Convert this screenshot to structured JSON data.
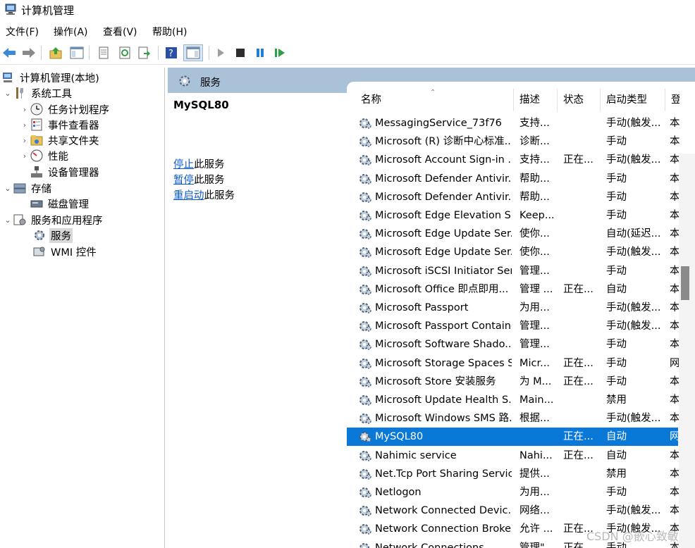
{
  "window": {
    "title": "计算机管理"
  },
  "menu": [
    "文件(F)",
    "操作(A)",
    "查看(V)",
    "帮助(H)"
  ],
  "toolbar": {
    "buttons": [
      "back-icon",
      "forward-icon",
      "up-icon",
      "show-hide-tree-icon",
      "properties-icon",
      "refresh-icon",
      "export-icon",
      "help-icon",
      "action-pane-icon",
      "start-icon",
      "stop-icon",
      "pause-icon",
      "resume-icon"
    ]
  },
  "tree": {
    "root": "计算机管理(本地)",
    "system_tools": "系统工具",
    "task_scheduler": "任务计划程序",
    "event_viewer": "事件查看器",
    "shared_folders": "共享文件夹",
    "performance": "性能",
    "device_manager": "设备管理器",
    "storage": "存储",
    "disk_management": "磁盘管理",
    "services_apps": "服务和应用程序",
    "services": "服务",
    "wmi": "WMI 控件"
  },
  "pane": {
    "title": "服务",
    "selected_service": "MySQL80",
    "actions": [
      {
        "link": "停止",
        "suffix": "此服务"
      },
      {
        "link": "暂停",
        "suffix": "此服务"
      },
      {
        "link": "重启动",
        "suffix": "此服务"
      }
    ]
  },
  "columns": {
    "name": "名称",
    "desc": "描述",
    "status": "状态",
    "startup": "启动类型",
    "logon": "登"
  },
  "services": [
    {
      "name": "MessagingService_73f76",
      "desc": "支持...",
      "status": "",
      "startup": "手动(触发...",
      "logon": "本"
    },
    {
      "name": "Microsoft (R) 诊断中心标准...",
      "desc": "诊断...",
      "status": "",
      "startup": "手动",
      "logon": "本"
    },
    {
      "name": "Microsoft Account Sign-in ...",
      "desc": "支持...",
      "status": "正在...",
      "startup": "手动(触发...",
      "logon": "本"
    },
    {
      "name": "Microsoft Defender Antivir...",
      "desc": "帮助...",
      "status": "",
      "startup": "手动",
      "logon": "本"
    },
    {
      "name": "Microsoft Defender Antivir...",
      "desc": "帮助...",
      "status": "",
      "startup": "手动",
      "logon": "本"
    },
    {
      "name": "Microsoft Edge Elevation S...",
      "desc": "Keep...",
      "status": "",
      "startup": "手动",
      "logon": "本"
    },
    {
      "name": "Microsoft Edge Update Ser...",
      "desc": "使你...",
      "status": "",
      "startup": "自动(延迟...",
      "logon": "本"
    },
    {
      "name": "Microsoft Edge Update Ser...",
      "desc": "使你...",
      "status": "",
      "startup": "手动(触发...",
      "logon": "本"
    },
    {
      "name": "Microsoft iSCSI Initiator Ser...",
      "desc": "管理...",
      "status": "",
      "startup": "手动",
      "logon": "本"
    },
    {
      "name": "Microsoft Office 即点即用...",
      "desc": "管理 ...",
      "status": "正在...",
      "startup": "自动",
      "logon": "本"
    },
    {
      "name": "Microsoft Passport",
      "desc": "为用...",
      "status": "",
      "startup": "手动(触发...",
      "logon": "本"
    },
    {
      "name": "Microsoft Passport Container",
      "desc": "管理...",
      "status": "",
      "startup": "手动(触发...",
      "logon": "本"
    },
    {
      "name": "Microsoft Software Shado...",
      "desc": "管理...",
      "status": "",
      "startup": "手动",
      "logon": "本"
    },
    {
      "name": "Microsoft Storage Spaces S...",
      "desc": "Micr...",
      "status": "正在...",
      "startup": "手动",
      "logon": "网"
    },
    {
      "name": "Microsoft Store 安装服务",
      "desc": "为 M...",
      "status": "正在...",
      "startup": "手动",
      "logon": "本"
    },
    {
      "name": "Microsoft Update Health S...",
      "desc": "Main...",
      "status": "",
      "startup": "禁用",
      "logon": "本"
    },
    {
      "name": "Microsoft Windows SMS 路...",
      "desc": "根据...",
      "status": "",
      "startup": "手动(触发...",
      "logon": "本"
    },
    {
      "name": "MySQL80",
      "desc": "",
      "status": "正在...",
      "startup": "自动",
      "logon": "网",
      "selected": true
    },
    {
      "name": "Nahimic service",
      "desc": "Nahi...",
      "status": "正在...",
      "startup": "自动",
      "logon": "本"
    },
    {
      "name": "Net.Tcp Port Sharing Service",
      "desc": "提供...",
      "status": "",
      "startup": "禁用",
      "logon": "本"
    },
    {
      "name": "Netlogon",
      "desc": "为用...",
      "status": "",
      "startup": "手动",
      "logon": "本"
    },
    {
      "name": "Network Connected Devic...",
      "desc": "网络...",
      "status": "",
      "startup": "手动(触发...",
      "logon": "本"
    },
    {
      "name": "Network Connection Broker",
      "desc": "允许 ...",
      "status": "正在...",
      "startup": "手动(触发...",
      "logon": "本"
    },
    {
      "name": "Network Connections",
      "desc": "管理\"...",
      "status": "正在...",
      "startup": "手动",
      "logon": "本"
    }
  ],
  "watermark": "CSDN @嵌心致敏",
  "colors": {
    "selection": "#0a78d7",
    "header": "#a9c2d8",
    "link": "#0a58c2"
  }
}
